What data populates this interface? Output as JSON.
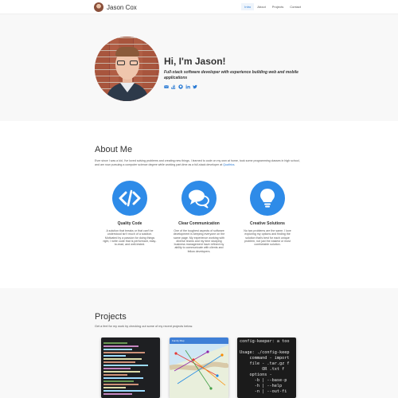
{
  "navbar": {
    "brand_name": "Jason Cox",
    "links": [
      {
        "label": "Intro",
        "active": true
      },
      {
        "label": "About",
        "active": false
      },
      {
        "label": "Projects",
        "active": false
      },
      {
        "label": "Contact",
        "active": false
      }
    ]
  },
  "hero": {
    "title": "Hi, I'm Jason!",
    "tagline": "Full-stack software developer with experience building web and mobile applications",
    "social_icons": [
      "email-icon",
      "stackoverflow-icon",
      "github-icon",
      "linkedin-icon",
      "twitter-icon"
    ]
  },
  "about": {
    "title": "About Me",
    "text": "Ever since I was a kid, I've loved solving problems and creating new things. I learned to code on my own at home, took some programming classes in high school, and am now pursuing a computer science degree while working part-time as a full-stack developer at",
    "company_link": "Qualtrics",
    "text_end": ".",
    "features": [
      {
        "icon": "code-icon",
        "name": "Quality Code",
        "desc": "A solution that breaks or that can't be understood isn't much of a solution. Motivated by a passion for doing things right, I write code that is performant, easy-to-read, and well-tested."
      },
      {
        "icon": "chat-bubbles-icon",
        "name": "Clear Communication",
        "desc": "One of the toughest aspects of software development is keeping everyone on the same page. My experience working with diverse teams and my time studying business management have refined my ability to communicate with clients and fellow developers."
      },
      {
        "icon": "lightbulb-icon",
        "name": "Creative Solutions",
        "desc": "No two problems are the same. I love exploring my options and finding the solution that's best for each unique problem, not just the easiest or most comfortable solution."
      }
    ]
  },
  "projects": {
    "title": "Projects",
    "subtitle": "Get a feel for my work by checking out some of my recent projects below.",
    "cards": [
      {
        "type": "code-screenshot"
      },
      {
        "type": "map-screenshot",
        "header": "Family Map"
      },
      {
        "type": "terminal-screenshot",
        "lines": [
          "config-keeper: a too",
          "",
          "Usage: ./config-keep",
          "    command - import",
          "    file - .tar.gz f",
          "         OR .txt f",
          "    options -",
          "      -b | --base-p",
          "      -h | --help",
          "      -n | --out-fi"
        ]
      }
    ]
  },
  "colors": {
    "accent": "#2e8be8",
    "link": "#2b7bd4",
    "section_bg": "#f8f8f8"
  }
}
